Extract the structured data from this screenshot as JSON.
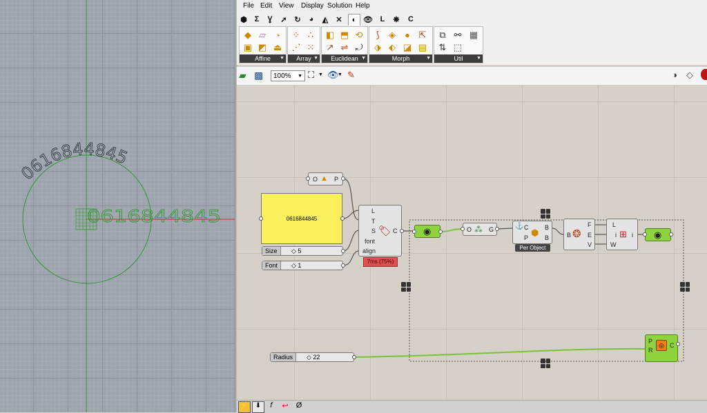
{
  "viewport": {
    "text_curved": "0616844845",
    "text_straight": "0616844845",
    "colors": {
      "background": "#9ea4ad",
      "circle": "#2e9a2e",
      "axis_x": "#c83232",
      "axis_y": "#2e9a2e"
    }
  },
  "menu": {
    "items": [
      "File",
      "Edit",
      "View",
      "Display",
      "Solution",
      "Help"
    ]
  },
  "tabs": {
    "icons": [
      "params-icon",
      "maths-icon",
      "sets-icon",
      "vector-icon",
      "curve-icon",
      "surface-icon",
      "mesh-icon",
      "intersect-icon",
      "transform-icon",
      "display-icon",
      "l-tab",
      "extra-icon",
      "c-tab"
    ],
    "letters": {
      "sigma": "Σ",
      "l": "L",
      "c": "C"
    }
  },
  "ribbon": {
    "panels": [
      {
        "label": "Affine"
      },
      {
        "label": "Array"
      },
      {
        "label": "Euclidean"
      },
      {
        "label": "Morph"
      },
      {
        "label": "Util"
      }
    ]
  },
  "toolbar": {
    "zoom": "100%"
  },
  "canvas": {
    "panel_text": "0616844845",
    "text_tag": {
      "inputs": [
        "L",
        "T",
        "S",
        "font",
        "align"
      ],
      "output": "C",
      "timing": "7ms (75%)"
    },
    "construct_point": {
      "input": "O",
      "output": "P"
    },
    "sliders": [
      {
        "name": "Size",
        "value": "5"
      },
      {
        "name": "Font",
        "value": "1"
      },
      {
        "name": "Radius",
        "value": "22"
      }
    ],
    "geometry_comp": {
      "input": "O",
      "output": "G"
    },
    "per_object": {
      "inputs": [
        "C",
        "P"
      ],
      "outputs": [
        "B",
        "B"
      ],
      "label": "Per Object"
    },
    "brep_comp": {
      "input": "B",
      "outputs": [
        "F",
        "E",
        "V"
      ]
    },
    "list_comp": {
      "inputs": [
        "L",
        "i",
        "W"
      ],
      "output": "i"
    },
    "circle_comp": {
      "inputs": [
        "P",
        "R"
      ],
      "output": "C"
    },
    "colors": {
      "panel_yellow": "#fbf05e",
      "param_green": "#8dd43f",
      "wire": "#7ac23a",
      "timing_red": "#e05050"
    }
  }
}
